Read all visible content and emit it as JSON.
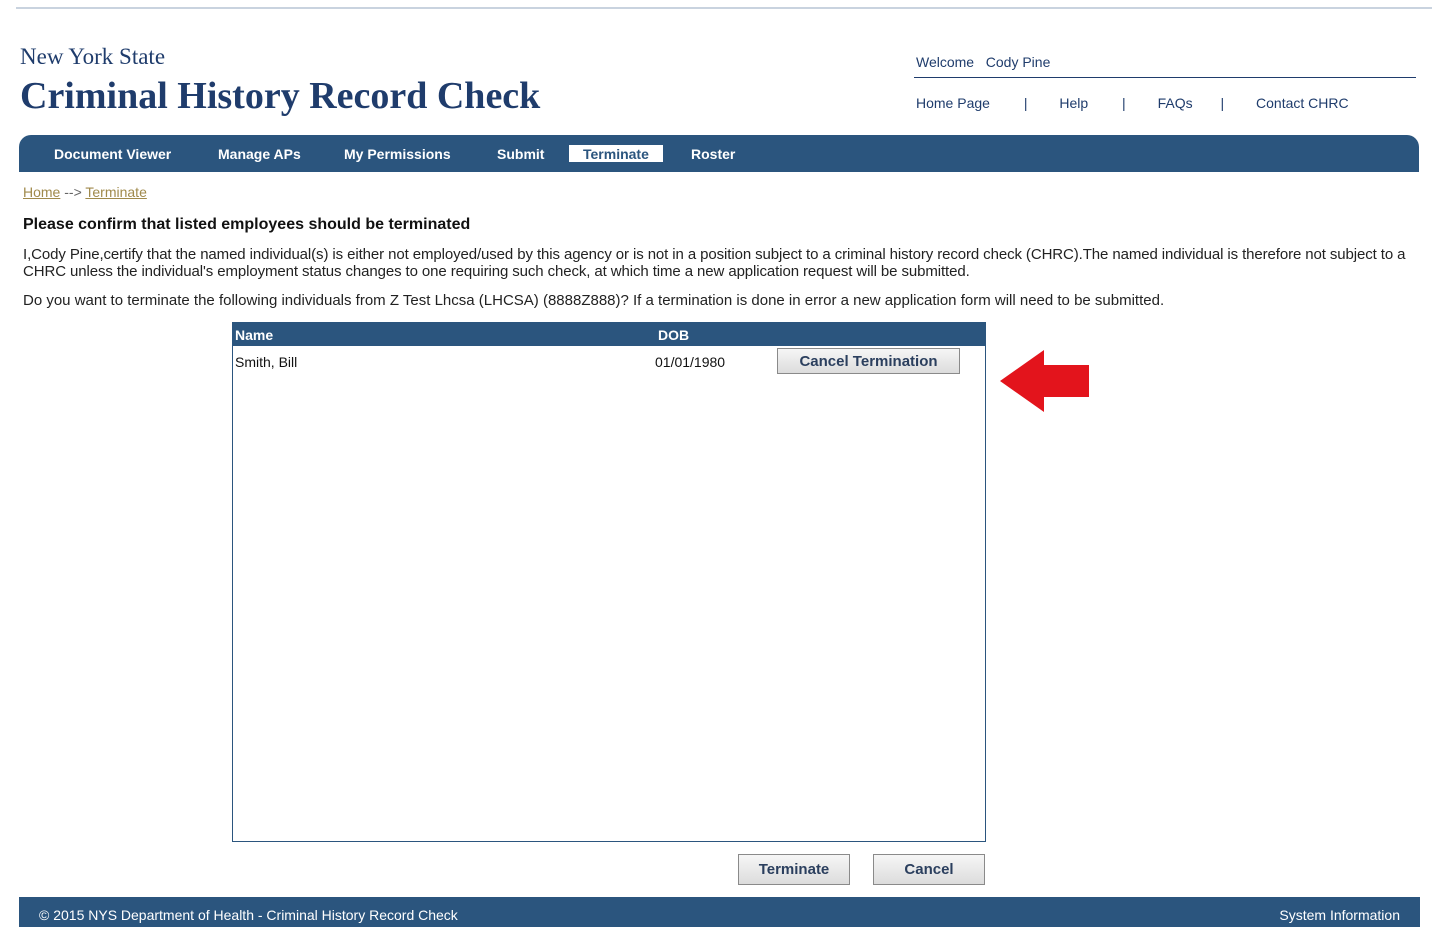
{
  "header": {
    "state": "New York State",
    "title": "Criminal History Record Check",
    "welcome_label": "Welcome",
    "user_name": "Cody Pine",
    "links": [
      "Home Page",
      "Help",
      "FAQs",
      "Contact CHRC"
    ],
    "separator": "|"
  },
  "nav": {
    "items": [
      "Document Viewer",
      "Manage APs",
      "My Permissions",
      "Submit",
      "Terminate",
      "Roster"
    ],
    "active": "Terminate"
  },
  "breadcrumb": {
    "home": "Home",
    "arrow": "-->",
    "current": "Terminate"
  },
  "main": {
    "heading": "Please confirm that listed employees should be terminated",
    "certify_text": "I,Cody Pine,certify that the named individual(s) is either not employed/used by this agency or is not in a position subject to a criminal history record check (CHRC).The named individual is therefore not subject to a CHRC unless the individual's employment status changes to one requiring such check, at which time a new application request will be submitted.",
    "question_text": "Do you want to terminate the following individuals from Z Test Lhcsa (LHCSA) (8888Z888)? If a termination is done in error a new application form will need to be submitted."
  },
  "grid": {
    "columns": [
      "Name",
      "DOB"
    ],
    "rows": [
      {
        "name": "Smith, Bill",
        "dob": "01/01/1980",
        "action": "Cancel Termination"
      }
    ]
  },
  "actions": {
    "terminate": "Terminate",
    "cancel": "Cancel"
  },
  "footer": {
    "copyright": "© 2015 NYS Department of Health - Criminal History Record Check",
    "system_info": "System Information"
  },
  "colors": {
    "nav_bg": "#2b557e",
    "brand": "#1f3c6c",
    "arrow": "#e3141c"
  },
  "icons": {
    "annotation": "red-left-arrow-icon"
  }
}
